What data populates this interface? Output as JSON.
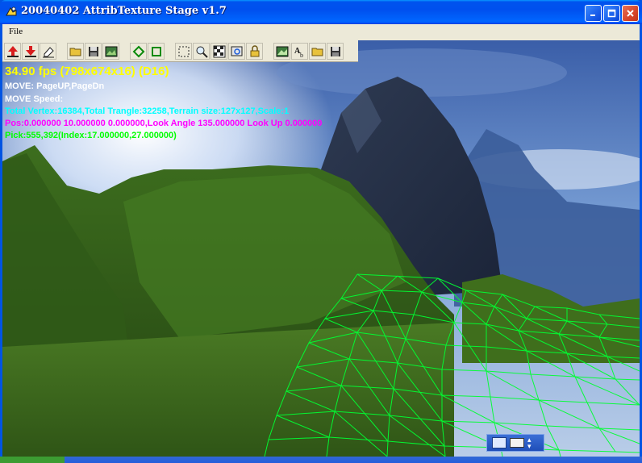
{
  "window": {
    "title": "20040402 AttribTexture Stage v1.7"
  },
  "menu": {
    "file_label": "File"
  },
  "hud": {
    "fps": "34.90 fps (798x674x16) (D16)",
    "move_line": "MOVE:                                                       PageUP,PageDn",
    "speed_line": "MOVE Speed:",
    "stats_line": "Total Vertex:16384,Total Trangle:32258,Terrain size:127x127,Scale:1",
    "pos_line": "Pos:0.000000 10.000000 0.000000,Look Angle 135.000000 Look Up 0.000000",
    "pick_line": "Pick:555,392(Index:17.000000,27.000000)"
  },
  "toolbar": {
    "tools": [
      "raise-terrain-icon",
      "lower-terrain-icon",
      "eraser-icon",
      "open-folder-icon",
      "save-disk-icon",
      "texture-icon",
      "circle-brush-icon",
      "square-brush-icon",
      "select-icon",
      "zoom-icon",
      "checker-icon",
      "find-icon",
      "lock-icon",
      "image-icon",
      "text-icon",
      "open-folder-icon",
      "save-disk-icon"
    ]
  },
  "colors": {
    "fps_text": "#ffff00",
    "info_text": "#ffffff",
    "stats_text": "#00ffff",
    "pos_text": "#ff00ff",
    "pick_text": "#00ff00",
    "wireframe": "#00ff33",
    "titlebar": "#0054e3"
  }
}
